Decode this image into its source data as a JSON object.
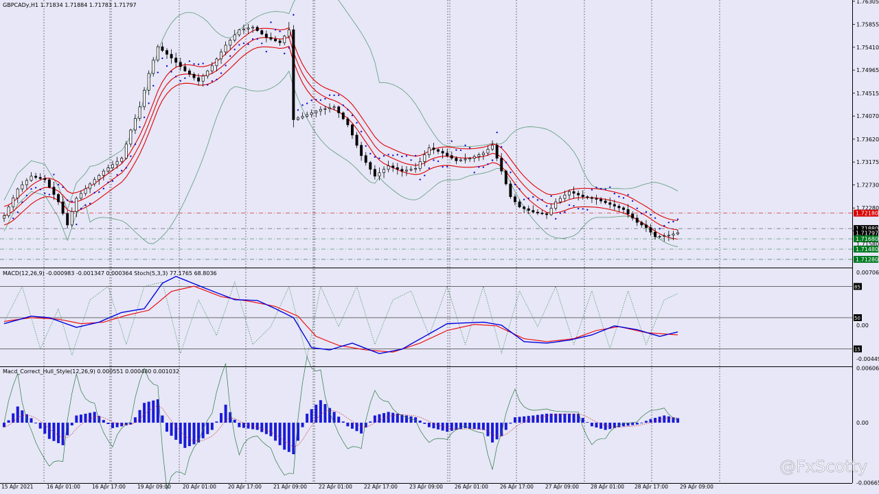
{
  "header": {
    "symbol_line": "GBPCADy,H1  1.71834 1.71884 1.71783 1.71797",
    "macd_line": "MACD(12,26,9) -0.000983 -0.001347 0.000364  Stoch(5,3,3) 77.1765 68.8036",
    "hull_line": "Macd_Correct_Hull_Style(12,26,9) 0.000551 0.000480 0.001032"
  },
  "watermark": "@FxScotty",
  "colors": {
    "background": "#e7e7f7",
    "candle": "#000000",
    "bollinger": "#5a9a78",
    "envelope": "#e00000",
    "sar": "#1010d0",
    "macd_main": "#0000dd",
    "macd_signal": "#ee0000",
    "stoch": "#3c8c50",
    "hull_hist": "#1a1ad8",
    "badge_red": "#d80000",
    "badge_green": "#007a20",
    "badge_black": "#000000"
  },
  "chart_data": [
    {
      "type": "candlestick",
      "title": "GBPCADy,H1",
      "ylim": [
        1.7112,
        1.7633
      ],
      "price_ticks": [
        "1.76305",
        "1.75855",
        "1.75410",
        "1.74965",
        "1.74515",
        "1.74070",
        "1.73620",
        "1.73175",
        "1.72730",
        "1.72280",
        "1.71835"
      ],
      "time_labels": [
        "15 Apr 2021",
        "16 Apr 01:00",
        "16 Apr 17:00",
        "19 Apr 09:00",
        "20 Apr 01:00",
        "20 Apr 17:00",
        "21 Apr 09:00",
        "22 Apr 01:00",
        "22 Apr 17:00",
        "23 Apr 09:00",
        "26 Apr 01:00",
        "26 Apr 17:00",
        "27 Apr 09:00",
        "28 Apr 01:00",
        "28 Apr 17:00",
        "29 Apr 09:00"
      ],
      "price_path": [
        [
          0,
          1.7213
        ],
        [
          3,
          1.7265
        ],
        [
          6,
          1.729
        ],
        [
          9,
          1.7283
        ],
        [
          12,
          1.724
        ],
        [
          14,
          1.7195
        ],
        [
          16,
          1.7247
        ],
        [
          19,
          1.7275
        ],
        [
          22,
          1.73
        ],
        [
          26,
          1.7325
        ],
        [
          28,
          1.738
        ],
        [
          30,
          1.7425
        ],
        [
          32,
          1.749
        ],
        [
          34,
          1.7542
        ],
        [
          37,
          1.752
        ],
        [
          40,
          1.7495
        ],
        [
          43,
          1.7475
        ],
        [
          46,
          1.7505
        ],
        [
          49,
          1.7545
        ],
        [
          52,
          1.7575
        ],
        [
          55,
          1.758
        ],
        [
          58,
          1.756
        ],
        [
          61,
          1.755
        ],
        [
          63,
          1.7575
        ],
        [
          64,
          1.74
        ],
        [
          67,
          1.741
        ],
        [
          70,
          1.742
        ],
        [
          73,
          1.7425
        ],
        [
          76,
          1.739
        ],
        [
          79,
          1.733
        ],
        [
          82,
          1.729
        ],
        [
          85,
          1.731
        ],
        [
          88,
          1.73
        ],
        [
          91,
          1.7305
        ],
        [
          94,
          1.7345
        ],
        [
          97,
          1.7335
        ],
        [
          100,
          1.732
        ],
        [
          103,
          1.7325
        ],
        [
          106,
          1.7335
        ],
        [
          108,
          1.735
        ],
        [
          110,
          1.73
        ],
        [
          112,
          1.725
        ],
        [
          114,
          1.723
        ],
        [
          117,
          1.722
        ],
        [
          120,
          1.7215
        ],
        [
          122,
          1.724
        ],
        [
          125,
          1.726
        ],
        [
          128,
          1.725
        ],
        [
          131,
          1.7245
        ],
        [
          134,
          1.7235
        ],
        [
          137,
          1.7225
        ],
        [
          140,
          1.72
        ],
        [
          142,
          1.719
        ],
        [
          144,
          1.7172
        ],
        [
          147,
          1.7175
        ],
        [
          149,
          1.718
        ]
      ],
      "horizontal_levels": [
        {
          "label": "1.72180",
          "value": 1.7218,
          "style": "red-dashdot",
          "badge": "red"
        },
        {
          "label": "1.71880",
          "value": 1.7188,
          "style": "gray-dashdot",
          "badge": "black"
        },
        {
          "label": "1.71797",
          "value": 1.71797,
          "style": "none",
          "badge": "black"
        },
        {
          "label": "1.71680",
          "value": 1.7168,
          "style": "green-dashdot",
          "badge": "green"
        },
        {
          "label": "1.71580",
          "value": 1.7158,
          "style": "none",
          "badge": "none"
        },
        {
          "label": "1.71480",
          "value": 1.7148,
          "style": "green-dashdot",
          "badge": "green"
        },
        {
          "label": "1.71280",
          "value": 1.7128,
          "style": "green-dashdot",
          "badge": "green"
        }
      ]
    },
    {
      "type": "line",
      "title": "MACD(12,26,9) / Stoch(5,3,3)",
      "ylim": [
        -0.0055,
        0.0075
      ],
      "y_ticks": [
        "0.007061",
        "0.00",
        "-0.004497"
      ],
      "stoch_levels": [
        "85",
        "50",
        "15"
      ],
      "macd_path": [
        [
          0,
          0.0002
        ],
        [
          6,
          0.0012
        ],
        [
          10,
          0.001
        ],
        [
          16,
          -0.0003
        ],
        [
          21,
          0.0004
        ],
        [
          26,
          0.0017
        ],
        [
          31,
          0.0022
        ],
        [
          35,
          0.0056
        ],
        [
          38,
          0.0065
        ],
        [
          45,
          0.0048
        ],
        [
          51,
          0.0034
        ],
        [
          56,
          0.0033
        ],
        [
          60,
          0.0022
        ],
        [
          64,
          0.001
        ],
        [
          68,
          -0.003
        ],
        [
          72,
          -0.0033
        ],
        [
          77,
          -0.0024
        ],
        [
          83,
          -0.0038
        ],
        [
          88,
          -0.0032
        ],
        [
          93,
          -0.0015
        ],
        [
          98,
          0.0002
        ],
        [
          102,
          0.0003
        ],
        [
          106,
          0.0004
        ],
        [
          110,
          0.0
        ],
        [
          115,
          -0.0022
        ],
        [
          120,
          -0.0024
        ],
        [
          125,
          -0.002
        ],
        [
          130,
          -0.0013
        ],
        [
          135,
          -0.0001
        ],
        [
          140,
          -0.0006
        ],
        [
          145,
          -0.0015
        ],
        [
          149,
          -0.0009
        ]
      ],
      "signal_path": [
        [
          0,
          0.0005
        ],
        [
          6,
          0.001
        ],
        [
          12,
          0.0008
        ],
        [
          17,
          0.0002
        ],
        [
          22,
          0.0004
        ],
        [
          27,
          0.0013
        ],
        [
          32,
          0.002
        ],
        [
          37,
          0.0045
        ],
        [
          42,
          0.0052
        ],
        [
          48,
          0.0038
        ],
        [
          55,
          0.0031
        ],
        [
          60,
          0.0025
        ],
        [
          65,
          0.0012
        ],
        [
          69,
          -0.0015
        ],
        [
          74,
          -0.0027
        ],
        [
          80,
          -0.0033
        ],
        [
          86,
          -0.0036
        ],
        [
          92,
          -0.0024
        ],
        [
          98,
          -0.0007
        ],
        [
          104,
          0.0001
        ],
        [
          109,
          -0.0001
        ],
        [
          115,
          -0.0018
        ],
        [
          120,
          -0.0022
        ],
        [
          126,
          -0.0018
        ],
        [
          131,
          -0.0007
        ],
        [
          136,
          -0.0002
        ],
        [
          142,
          -0.001
        ],
        [
          149,
          -0.0013
        ]
      ],
      "stoch_path": [
        [
          0,
          45
        ],
        [
          4,
          85
        ],
        [
          8,
          15
        ],
        [
          12,
          60
        ],
        [
          15,
          8
        ],
        [
          19,
          70
        ],
        [
          23,
          85
        ],
        [
          27,
          20
        ],
        [
          31,
          85
        ],
        [
          35,
          90
        ],
        [
          39,
          10
        ],
        [
          43,
          70
        ],
        [
          47,
          30
        ],
        [
          51,
          90
        ],
        [
          55,
          20
        ],
        [
          59,
          40
        ],
        [
          63,
          85
        ],
        [
          67,
          5
        ],
        [
          70,
          85
        ],
        [
          74,
          40
        ],
        [
          78,
          85
        ],
        [
          82,
          20
        ],
        [
          86,
          70
        ],
        [
          90,
          80
        ],
        [
          94,
          30
        ],
        [
          98,
          85
        ],
        [
          102,
          20
        ],
        [
          106,
          85
        ],
        [
          110,
          10
        ],
        [
          114,
          80
        ],
        [
          118,
          40
        ],
        [
          122,
          85
        ],
        [
          126,
          20
        ],
        [
          130,
          80
        ],
        [
          134,
          15
        ],
        [
          138,
          80
        ],
        [
          142,
          20
        ],
        [
          146,
          70
        ],
        [
          149,
          77
        ]
      ]
    },
    {
      "type": "bar",
      "title": "Macd_Correct_Hull_Style(12,26,9)",
      "ylim": [
        -0.0067,
        0.0061
      ],
      "y_ticks": [
        "0.006069",
        "0.00",
        "-0.006653"
      ],
      "hist_path": [
        [
          0,
          -0.0005
        ],
        [
          3,
          0.0018
        ],
        [
          6,
          0.0005
        ],
        [
          10,
          -0.0018
        ],
        [
          13,
          -0.0025
        ],
        [
          16,
          0.0008
        ],
        [
          20,
          0.0012
        ],
        [
          24,
          -0.0006
        ],
        [
          28,
          -0.0002
        ],
        [
          31,
          0.0022
        ],
        [
          34,
          0.0026
        ],
        [
          36,
          -0.001
        ],
        [
          40,
          -0.0028
        ],
        [
          43,
          -0.0022
        ],
        [
          46,
          -0.0008
        ],
        [
          49,
          0.002
        ],
        [
          52,
          -0.0005
        ],
        [
          56,
          -0.0008
        ],
        [
          59,
          -0.0015
        ],
        [
          62,
          -0.003
        ],
        [
          64,
          -0.0035
        ],
        [
          67,
          0.001
        ],
        [
          70,
          0.0025
        ],
        [
          73,
          0.0012
        ],
        [
          76,
          -0.0004
        ],
        [
          79,
          -0.0012
        ],
        [
          82,
          0.0008
        ],
        [
          85,
          0.0012
        ],
        [
          88,
          0.0009
        ],
        [
          91,
          0.0006
        ],
        [
          94,
          -0.0005
        ],
        [
          98,
          -0.001
        ],
        [
          102,
          -0.0006
        ],
        [
          106,
          -0.0008
        ],
        [
          108,
          -0.0022
        ],
        [
          110,
          -0.0015
        ],
        [
          113,
          0.0006
        ],
        [
          117,
          0.0008
        ],
        [
          120,
          0.001
        ],
        [
          124,
          0.001
        ],
        [
          127,
          0.001
        ],
        [
          130,
          -0.0004
        ],
        [
          133,
          -0.0008
        ],
        [
          137,
          -0.0004
        ],
        [
          140,
          -0.0002
        ],
        [
          143,
          0.0004
        ],
        [
          146,
          0.0008
        ],
        [
          149,
          0.0005
        ]
      ]
    }
  ]
}
